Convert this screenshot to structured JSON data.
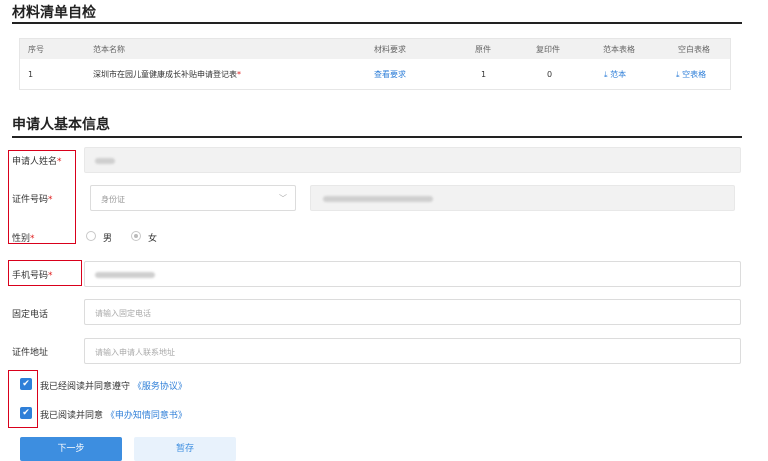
{
  "section1": {
    "title": "材料清单自检",
    "table": {
      "headers": [
        "序号",
        "范本名称",
        "材料要求",
        "原件",
        "复印件",
        "范本表格",
        "空白表格"
      ],
      "rows": [
        {
          "index": "1",
          "name": "深圳市在园儿童健康成长补贴申请登记表",
          "required_mark": "*",
          "requirement_link": "查看要求",
          "original": "1",
          "copy": "0",
          "sample_link": "范本",
          "blank_link": "空表格"
        }
      ]
    }
  },
  "section2": {
    "title": "申请人基本信息",
    "fields": {
      "name_label": "申请人姓名",
      "id_label": "证件号码",
      "id_type_value": "身份证",
      "gender_label": "性别",
      "gender_male": "男",
      "gender_female": "女",
      "phone_label": "手机号码",
      "landline_label": "固定电话",
      "landline_placeholder": "请输入固定电话",
      "address_label": "证件地址",
      "address_placeholder": "请输入申请人联系地址",
      "required_mark": "*"
    },
    "agreements": [
      {
        "text": "我已经阅读并同意遵守",
        "link": "《服务协议》"
      },
      {
        "text": "我已阅读并同意",
        "link": "《申办知情同意书》"
      }
    ],
    "buttons": {
      "next": "下一步",
      "save": "暂存"
    }
  },
  "colors": {
    "accent": "#3d8ee0",
    "required": "#e02020",
    "highlight_box": "#d9001b"
  }
}
